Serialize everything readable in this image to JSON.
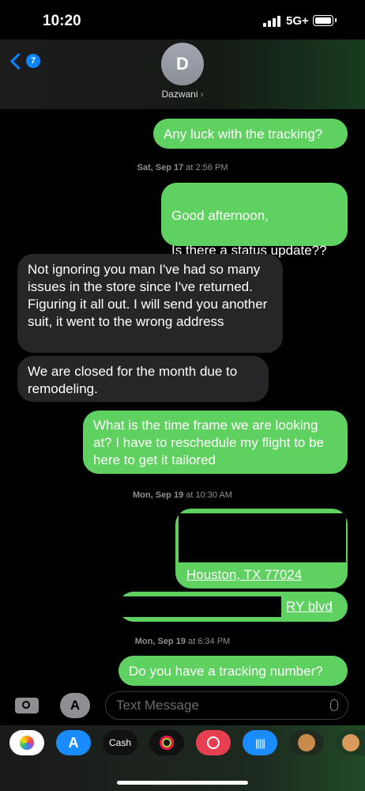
{
  "status_bar": {
    "time": "10:20",
    "network": "5G+"
  },
  "header": {
    "back_count": "7",
    "avatar_initial": "D",
    "contact_name": "Dazwani"
  },
  "messages": [
    {
      "type": "sent",
      "text": "Any luck with the tracking?"
    },
    {
      "type": "timestamp",
      "day": "Sat, Sep 17",
      "time": "at 2:56 PM"
    },
    {
      "type": "sent",
      "text": "Good afternoon,\n\nIs there a status update??"
    },
    {
      "type": "received",
      "text": "Not ignoring you man I've had so many issues in the store since I've returned. Figuring it all out. I will send you another suit, it went to the wrong address"
    },
    {
      "type": "received",
      "text": "We are closed for the month due to remodeling."
    },
    {
      "type": "sent",
      "text": "What is the time frame we are looking at? I have to reschedule my flight to be here to get it tailored"
    },
    {
      "type": "timestamp",
      "day": "Mon, Sep 19",
      "time": "at 10:30 AM"
    },
    {
      "type": "sent",
      "text": "Houston, TX 77024"
    },
    {
      "type": "sent",
      "text": "RY blvd"
    },
    {
      "type": "timestamp",
      "day": "Mon, Sep 19",
      "time": "at 6:34 PM"
    },
    {
      "type": "sent",
      "text": "Do you have a tracking number?"
    }
  ],
  "input": {
    "placeholder": "Text Message"
  },
  "app_strip": [
    {
      "name": "photos",
      "label": ""
    },
    {
      "name": "app-store",
      "label": "A"
    },
    {
      "name": "apple-cash",
      "label": "Cash"
    },
    {
      "name": "fitness",
      "label": ""
    },
    {
      "name": "search-web",
      "label": ""
    },
    {
      "name": "audio",
      "label": ""
    },
    {
      "name": "memoji",
      "label": ""
    },
    {
      "name": "memoji-2",
      "label": ""
    }
  ]
}
